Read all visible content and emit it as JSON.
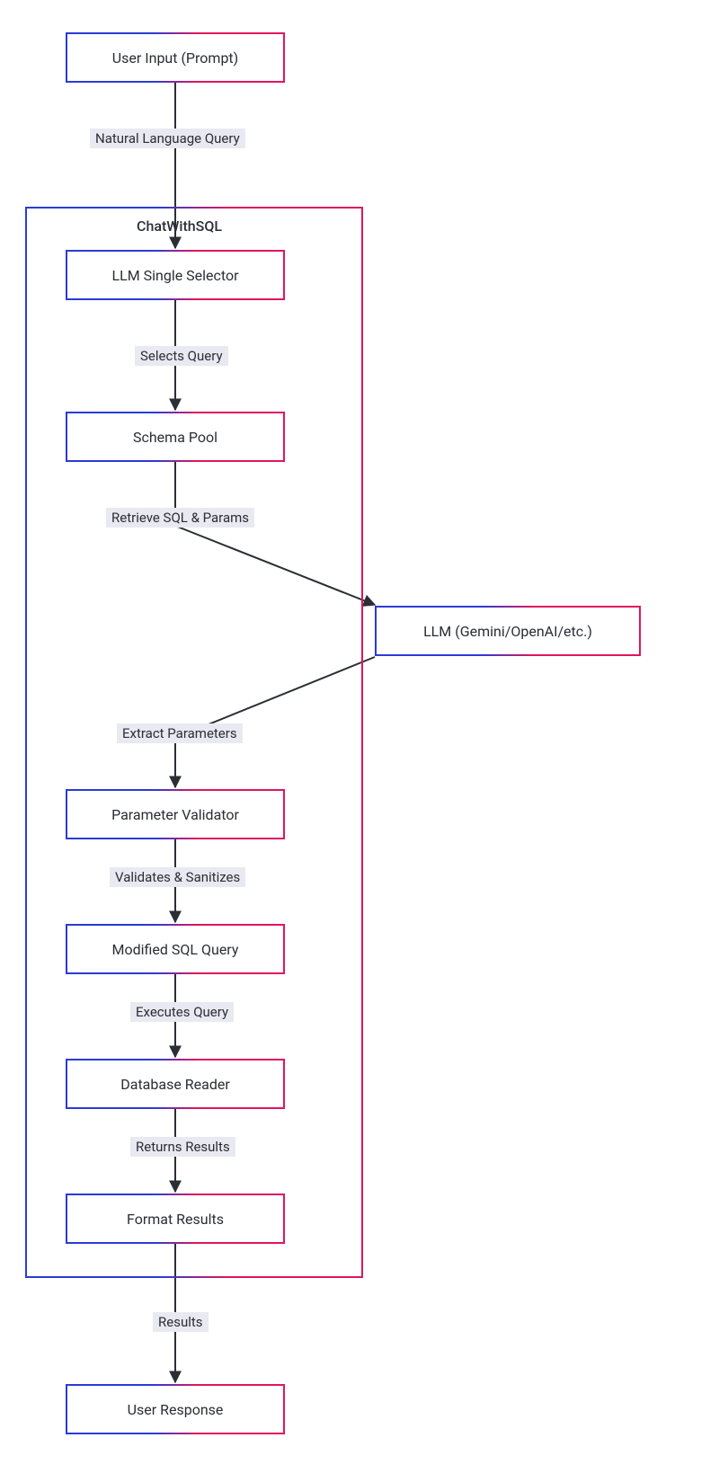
{
  "nodes": {
    "user_input": "User Input (Prompt)",
    "llm_selector": "LLM Single Selector",
    "schema_pool": "Schema Pool",
    "llm_external": "LLM (Gemini/OpenAI/etc.)",
    "param_validator": "Parameter Validator",
    "modified_sql": "Modified SQL Query",
    "db_reader": "Database Reader",
    "format_results": "Format Results",
    "user_response": "User Response"
  },
  "group": {
    "label": "ChatWithSQL"
  },
  "edges": {
    "nlq": "Natural Language Query",
    "selects": "Selects Query",
    "retrieve": "Retrieve SQL & Params",
    "extract": "Extract Parameters",
    "validates": "Validates & Sanitizes",
    "executes": "Executes Query",
    "returns": "Returns Results",
    "results": "Results",
    "none": ""
  }
}
